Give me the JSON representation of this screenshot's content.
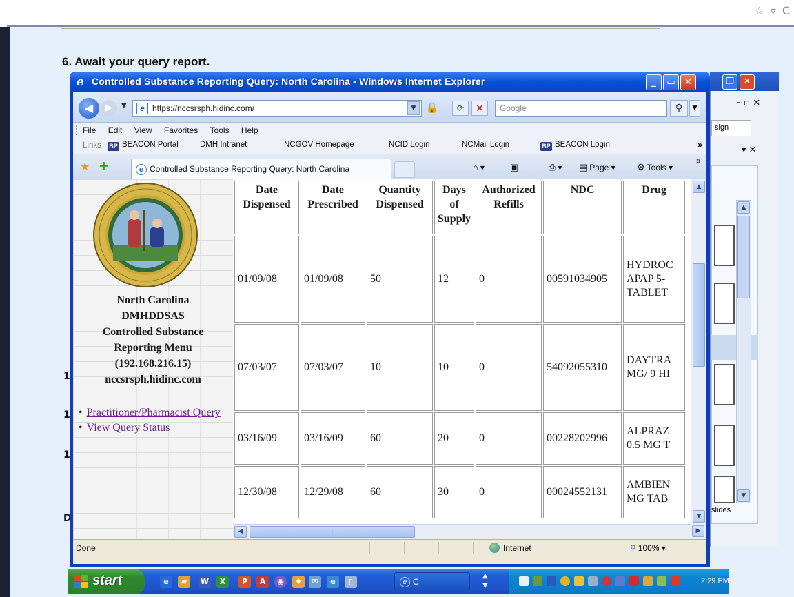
{
  "top_controls": [
    "☆",
    "▿",
    "C"
  ],
  "slide": {
    "step_title": "6.  Await your query report.",
    "left_marks": [
      "1",
      "1",
      "1",
      "D"
    ]
  },
  "bg_window": {
    "restore": "❐",
    "close": "✕",
    "controls": "– ▫ ✕",
    "sign_text": "sign",
    "pane_close": "▾ ✕",
    "slides_label": "slides"
  },
  "ie_window": {
    "title": "Controlled Substance Reporting Query: North Carolina - Windows Internet Explorer",
    "min": "_",
    "max": "▭",
    "close": "✕",
    "address": "https://nccsrsph.hidinc.com/",
    "search_placeholder": "Google",
    "menu": [
      "File",
      "Edit",
      "View",
      "Favorites",
      "Tools",
      "Help"
    ],
    "links_label": "Links",
    "links": [
      {
        "label": "BEACON Portal",
        "icon": "beacon"
      },
      {
        "label": "DMH Intranet",
        "icon": "ie"
      },
      {
        "label": "NCGOV Homepage",
        "icon": "ie"
      },
      {
        "label": "NCID Login",
        "icon": "ie"
      },
      {
        "label": "NCMail Login",
        "icon": "ie"
      },
      {
        "label": "BEACON Login",
        "icon": "beacon"
      }
    ],
    "tab_title": "Controlled Substance Reporting Query: North Carolina",
    "commands": {
      "page": "Page",
      "tools": "Tools"
    },
    "status_done": "Done",
    "status_zone": "Internet",
    "status_zoom": "100%"
  },
  "left_pane": {
    "org_lines": [
      "North Carolina",
      "DMHDDSAS",
      "Controlled Substance",
      "Reporting Menu",
      "(192.168.216.15)",
      "nccsrsph.hidinc.com"
    ],
    "nav": [
      {
        "label": "Practitioner/Pharmacist Query"
      },
      {
        "label": "View Query Status"
      }
    ]
  },
  "table": {
    "headers": [
      [
        "Date",
        "Dispensed"
      ],
      [
        "Date",
        "Prescribed"
      ],
      [
        "Quantity",
        "Dispensed"
      ],
      [
        "Days",
        "of",
        "Supply"
      ],
      [
        "Authorized",
        "Refills"
      ],
      [
        "NDC"
      ],
      [
        "Drug"
      ]
    ],
    "rows": [
      {
        "date_dispensed": "01/09/08",
        "date_prescribed": "01/09/08",
        "quantity": "50",
        "days": "12",
        "refills": "0",
        "ndc": "00591034905",
        "drug": [
          "HYDROC",
          "APAP 5-",
          "TABLET"
        ]
      },
      {
        "date_dispensed": "07/03/07",
        "date_prescribed": "07/03/07",
        "quantity": "10",
        "days": "10",
        "refills": "0",
        "ndc": "54092055310",
        "drug": [
          "DAYTRA",
          "MG/ 9 HI"
        ]
      },
      {
        "date_dispensed": "03/16/09",
        "date_prescribed": "03/16/09",
        "quantity": "60",
        "days": "20",
        "refills": "0",
        "ndc": "00228202996",
        "drug": [
          "ALPRAZ",
          "0.5 MG T"
        ]
      },
      {
        "date_dispensed": "12/30/08",
        "date_prescribed": "12/29/08",
        "quantity": "60",
        "days": "30",
        "refills": "0",
        "ndc": "00024552131",
        "drug": [
          "AMBIEN",
          "MG TAB"
        ]
      }
    ]
  },
  "taskbar": {
    "start_label": "start",
    "task_label": "C",
    "clock": "2:29 PM"
  }
}
